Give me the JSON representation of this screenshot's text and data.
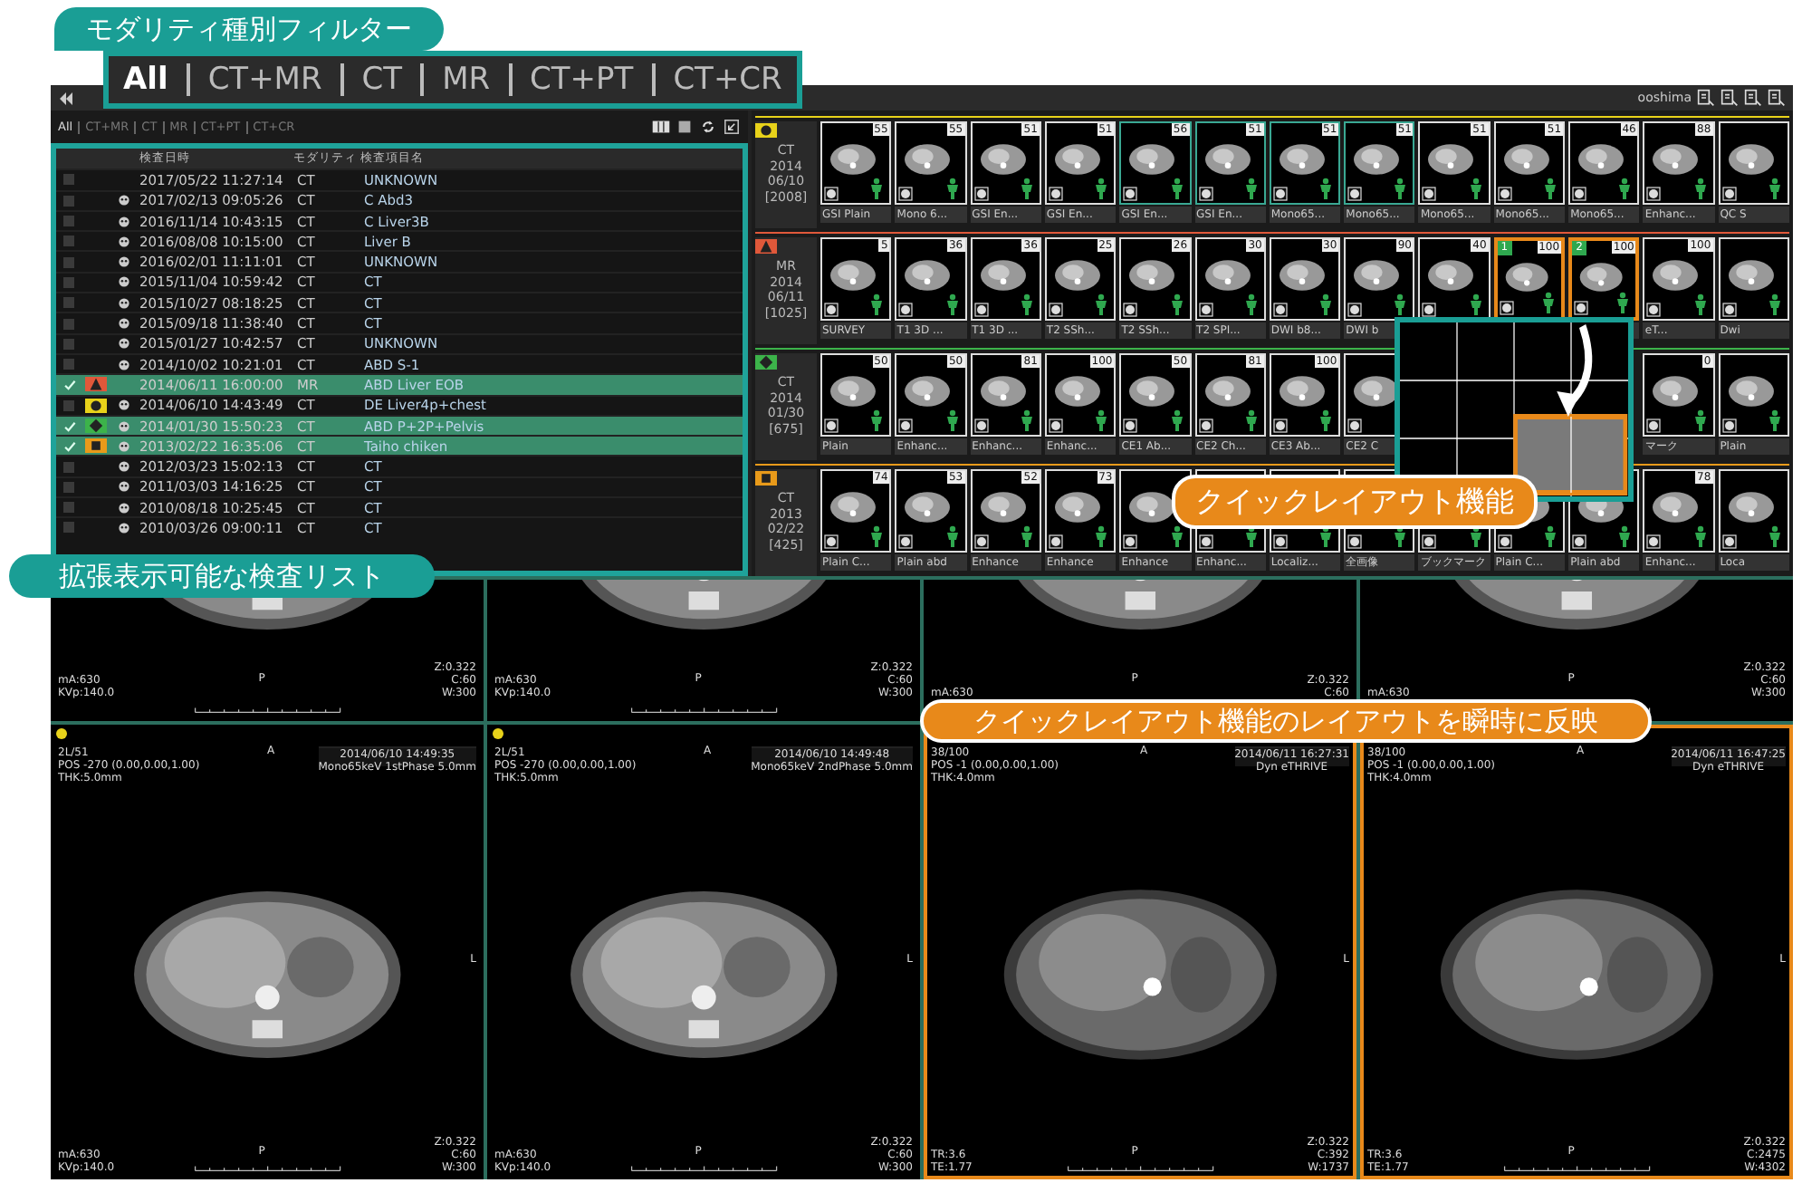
{
  "topbar": {
    "user": "ooshima"
  },
  "filter_callout": {
    "label": "モダリティ種別フィルター",
    "filters": [
      {
        "label": "All",
        "selected": true
      },
      {
        "label": "CT+MR",
        "selected": false
      },
      {
        "label": "CT",
        "selected": false
      },
      {
        "label": "MR",
        "selected": false
      },
      {
        "label": "CT+PT",
        "selected": false
      },
      {
        "label": "CT+CR",
        "selected": false
      }
    ]
  },
  "exam_list": {
    "filters": [
      {
        "label": "All",
        "selected": true
      },
      {
        "label": "CT+MR",
        "selected": false
      },
      {
        "label": "CT",
        "selected": false
      },
      {
        "label": "MR",
        "selected": false
      },
      {
        "label": "CT+PT",
        "selected": false
      },
      {
        "label": "CT+CR",
        "selected": false
      }
    ],
    "columns": [
      "検査日時",
      "モダリティ",
      "検査項目名"
    ],
    "rows": [
      {
        "checked": false,
        "selected": false,
        "icon": false,
        "date": "2017/05/22 11:27:14",
        "modality": "CT",
        "description": "UNKNOWN"
      },
      {
        "checked": false,
        "selected": false,
        "icon": true,
        "date": "2017/02/13 09:05:26",
        "modality": "CT",
        "description": "C Abd3"
      },
      {
        "checked": false,
        "selected": false,
        "icon": true,
        "date": "2016/11/14 10:43:15",
        "modality": "CT",
        "description": "C Liver3B"
      },
      {
        "checked": false,
        "selected": false,
        "icon": true,
        "date": "2016/08/08 10:15:00",
        "modality": "CT",
        "description": "Liver B"
      },
      {
        "checked": false,
        "selected": false,
        "icon": true,
        "date": "2016/02/01 11:11:01",
        "modality": "CT",
        "description": "UNKNOWN"
      },
      {
        "checked": false,
        "selected": false,
        "icon": true,
        "date": "2015/11/04 10:59:42",
        "modality": "CT",
        "description": "CT"
      },
      {
        "checked": false,
        "selected": false,
        "icon": true,
        "date": "2015/10/27 08:18:25",
        "modality": "CT",
        "description": "CT"
      },
      {
        "checked": false,
        "selected": false,
        "icon": true,
        "date": "2015/09/18 11:38:40",
        "modality": "CT",
        "description": "CT"
      },
      {
        "checked": false,
        "selected": false,
        "icon": true,
        "date": "2015/01/27 10:42:57",
        "modality": "CT",
        "description": "UNKNOWN"
      },
      {
        "checked": false,
        "selected": false,
        "icon": true,
        "date": "2014/10/02 10:21:01",
        "modality": "CT",
        "description": "ABD S-1"
      },
      {
        "checked": true,
        "selected": true,
        "kind": "triangle",
        "color": "#e0583a",
        "icon": false,
        "date": "2014/06/11 16:00:00",
        "modality": "MR",
        "description": "ABD Liver EOB"
      },
      {
        "checked": false,
        "selected": false,
        "kind": "circle",
        "color": "#e8d21a",
        "icon": true,
        "date": "2014/06/10 14:43:49",
        "modality": "CT",
        "description": "DE Liver4p+chest"
      },
      {
        "checked": true,
        "selected": true,
        "kind": "diamond",
        "color": "#3cb34a",
        "icon": true,
        "date": "2014/01/30 15:50:23",
        "modality": "CT",
        "description": "ABD P+2P+Pelvis"
      },
      {
        "checked": true,
        "selected": true,
        "kind": "square",
        "color": "#e89a1a",
        "icon": true,
        "date": "2013/02/22 16:35:06",
        "modality": "CT",
        "description": "Taiho chiken"
      },
      {
        "checked": false,
        "selected": false,
        "icon": true,
        "date": "2012/03/23 15:02:13",
        "modality": "CT",
        "description": "CT"
      },
      {
        "checked": false,
        "selected": false,
        "icon": true,
        "date": "2011/03/03 14:16:25",
        "modality": "CT",
        "description": "CT"
      },
      {
        "checked": false,
        "selected": false,
        "icon": true,
        "date": "2010/08/18 10:25:45",
        "modality": "CT",
        "description": "CT"
      },
      {
        "checked": false,
        "selected": false,
        "icon": true,
        "date": "2010/03/26 09:00:11",
        "modality": "CT",
        "description": "CT"
      }
    ]
  },
  "list_callout": {
    "label": "拡張表示可能な検査リスト"
  },
  "series_rows": [
    {
      "kind": "circle",
      "color": "#e8d21a",
      "modality": "CT",
      "year": "2014",
      "date": "06/10",
      "count": "[2008]",
      "thumbnails": [
        {
          "number": "55",
          "caption": "GSI Plain",
          "selected": false
        },
        {
          "number": "55",
          "caption": "Mono 6...",
          "selected": false
        },
        {
          "number": "51",
          "caption": "GSI En...",
          "selected": false
        },
        {
          "number": "51",
          "caption": "GSI En...",
          "selected": false
        },
        {
          "number": "56",
          "caption": "GSI En...",
          "selected": true
        },
        {
          "number": "51",
          "caption": "GSI En...",
          "selected": true
        },
        {
          "number": "51",
          "caption": "Mono65...",
          "selected": true
        },
        {
          "number": "51",
          "caption": "Mono65...",
          "selected": true
        },
        {
          "number": "51",
          "caption": "Mono65...",
          "selected": false
        },
        {
          "number": "51",
          "caption": "Mono65...",
          "selected": false
        },
        {
          "number": "46",
          "caption": "Mono65...",
          "selected": false
        },
        {
          "number": "88",
          "caption": "Enhanc...",
          "selected": false
        },
        {
          "caption": "QC S",
          "selected": false
        }
      ]
    },
    {
      "kind": "triangle",
      "color": "#e0583a",
      "modality": "MR",
      "year": "2014",
      "date": "06/11",
      "count": "[1025]",
      "thumbnails": [
        {
          "number": "5",
          "caption": "SURVEY",
          "selected": false
        },
        {
          "number": "36",
          "caption": "T1 3D ...",
          "selected": false
        },
        {
          "number": "36",
          "caption": "T1 3D ...",
          "selected": false
        },
        {
          "number": "25",
          "caption": "T2 SSh...",
          "selected": false
        },
        {
          "number": "26",
          "caption": "T2 SSh...",
          "selected": false
        },
        {
          "number": "30",
          "caption": "T2 SPI...",
          "selected": false
        },
        {
          "number": "30",
          "caption": "DWI b8...",
          "selected": false
        },
        {
          "number": "90",
          "caption": "DWI b",
          "selected": false
        },
        {
          "number": "40",
          "selected": false
        },
        {
          "number": "100",
          "slot": "1"
        },
        {
          "number": "100",
          "slot": "2"
        },
        {
          "number": "100",
          "caption": "eT...",
          "selected": false
        },
        {
          "caption": "Dwi",
          "selected": false
        }
      ]
    },
    {
      "kind": "diamond",
      "color": "#3cb34a",
      "modality": "CT",
      "year": "2014",
      "date": "01/30",
      "count": "[675]",
      "thumbnails": [
        {
          "number": "50",
          "caption": "Plain",
          "selected": false
        },
        {
          "number": "50",
          "caption": "Enhanc...",
          "selected": false
        },
        {
          "number": "81",
          "caption": "Enhanc...",
          "selected": false
        },
        {
          "number": "100",
          "caption": "Enhanc...",
          "selected": false
        },
        {
          "number": "50",
          "caption": "CE1 Ab...",
          "selected": false
        },
        {
          "number": "81",
          "caption": "CE2 Ch...",
          "selected": false
        },
        {
          "number": "100",
          "caption": "CE3 Ab...",
          "selected": false
        },
        {
          "caption": "CE2 C",
          "selected": false
        }
      ],
      "thumbnails_end": [
        {
          "number": "0",
          "caption": "マーク",
          "selected": false
        },
        {
          "caption": "Plain",
          "selected": false
        }
      ]
    },
    {
      "kind": "square",
      "color": "#e89a1a",
      "modality": "CT",
      "year": "2013",
      "date": "02/22",
      "count": "[425]",
      "thumbnails": [
        {
          "number": "74",
          "caption": "Plain C...",
          "selected": false
        },
        {
          "number": "53",
          "caption": "Plain abd",
          "selected": false
        },
        {
          "number": "52",
          "caption": "Enhance",
          "selected": false
        },
        {
          "number": "73",
          "caption": "Enhance",
          "selected": false
        },
        {
          "caption": "Enhance",
          "selected": false
        },
        {
          "caption": "Enhanc...",
          "selected": false
        },
        {
          "caption": "Localiz...",
          "selected": false
        },
        {
          "caption": "全画像",
          "selected": false
        },
        {
          "caption": "ブックマーク",
          "selected": false
        },
        {
          "caption": "Plain C...",
          "selected": false
        },
        {
          "caption": "Plain abd",
          "selected": false
        },
        {
          "number": "78",
          "caption": "Enhanc...",
          "selected": false
        },
        {
          "caption": "Loca",
          "selected": false
        }
      ]
    }
  ],
  "layout_callout": {
    "label": "クイックレイアウト機能"
  },
  "reflect_callout": {
    "label": "クイックレイアウト機能のレイアウトを瞬時に反映"
  },
  "viewports": [
    {
      "kind": "ct",
      "highlighted": false,
      "bottom_left": [
        "mA:630",
        "KVp:140.0"
      ],
      "bottom_right": [
        "Z:0.322",
        "C:60",
        "W:300"
      ],
      "bottom": "P"
    },
    {
      "kind": "ct",
      "highlighted": false,
      "bottom_left": [
        "mA:630",
        "KVp:140.0"
      ],
      "bottom_right": [
        "Z:0.322",
        "C:60",
        "W:300"
      ],
      "bottom": "P"
    },
    {
      "kind": "ct",
      "highlighted": false,
      "bottom_left": [
        "mA:630"
      ],
      "bottom_right": [
        "Z:0.322",
        "C:60"
      ],
      "bottom": "P"
    },
    {
      "kind": "ct",
      "highlighted": false,
      "bottom_left": [
        "mA:630"
      ],
      "bottom_right": [
        "Z:0.322",
        "C:60",
        "W:300"
      ],
      "bottom": "P"
    },
    {
      "kind": "ct",
      "highlighted": false,
      "dot": true,
      "top": "A",
      "top_left": [
        "2L/51",
        "POS -270 (0.00,0.00,1.00)",
        "THK:5.0mm"
      ],
      "top_right": [
        "2014/06/10 14:49:35",
        "Mono65keV 1stPhase 5.0mm"
      ],
      "right": "L",
      "bottom_left": [
        "mA:630",
        "KVp:140.0"
      ],
      "bottom_right": [
        "Z:0.322",
        "C:60",
        "W:300"
      ],
      "bottom": "P"
    },
    {
      "kind": "ct",
      "highlighted": false,
      "dot": true,
      "top": "A",
      "top_left": [
        "2L/51",
        "POS -270 (0.00,0.00,1.00)",
        "THK:5.0mm"
      ],
      "top_right": [
        "2014/06/10 14:49:48",
        "Mono65keV 2ndPhase 5.0mm"
      ],
      "right": "L",
      "bottom_left": [
        "mA:630",
        "KVp:140.0"
      ],
      "bottom_right": [
        "Z:0.322",
        "C:60",
        "W:300"
      ],
      "bottom": "P"
    },
    {
      "kind": "mr",
      "highlighted": true,
      "top": "A",
      "top_left": [
        "38/100",
        "POS -1 (0.00,0.00,1.00)",
        "THK:4.0mm"
      ],
      "top_right": [
        "2014/06/11 16:27:31",
        "Dyn eTHRIVE"
      ],
      "right": "L",
      "bottom_left": [
        "TR:3.6",
        "TE:1.77"
      ],
      "bottom_right": [
        "Z:0.322",
        "C:392",
        "W:1737"
      ],
      "bottom": "P"
    },
    {
      "kind": "mr",
      "highlighted": true,
      "top": "A",
      "top_left": [
        "38/100",
        "POS -1 (0.00,0.00,1.00)",
        "THK:4.0mm"
      ],
      "top_right": [
        "2014/06/11 16:47:25",
        "Dyn eTHRIVE"
      ],
      "right": "L",
      "bottom_left": [
        "TR:3.6",
        "TE:1.77"
      ],
      "bottom_right": [
        "Z:0.322",
        "C:2475",
        "W:4302"
      ],
      "bottom": "P"
    }
  ]
}
